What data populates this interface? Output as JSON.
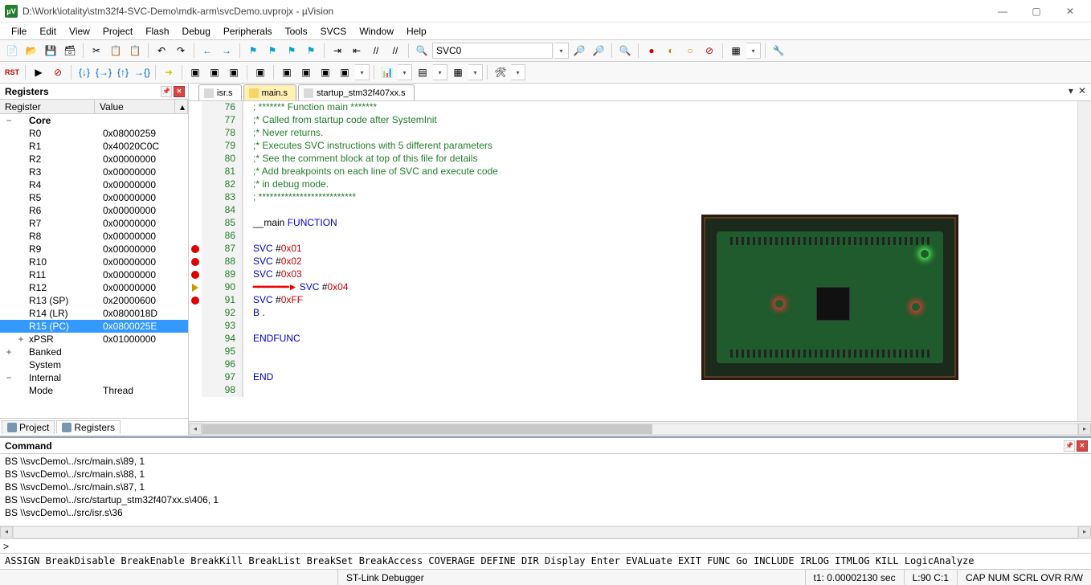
{
  "window": {
    "title": "D:\\Work\\iotality\\stm32f4-SVC-Demo\\mdk-arm\\svcDemo.uvprojx - µVision"
  },
  "menu": [
    "File",
    "Edit",
    "View",
    "Project",
    "Flash",
    "Debug",
    "Peripherals",
    "Tools",
    "SVCS",
    "Window",
    "Help"
  ],
  "toolbar": {
    "search_value": "SVC0"
  },
  "registers": {
    "title": "Registers",
    "col_register": "Register",
    "col_value": "Value",
    "groups": {
      "core": {
        "name": "Core",
        "expand": "−"
      },
      "banked": {
        "name": "Banked",
        "expand": "+"
      },
      "system": {
        "name": "System",
        "expand": ""
      },
      "internal": {
        "name": "Internal",
        "expand": "−"
      }
    },
    "core_regs": [
      {
        "n": "R0",
        "v": "0x08000259"
      },
      {
        "n": "R1",
        "v": "0x40020C0C"
      },
      {
        "n": "R2",
        "v": "0x00000000"
      },
      {
        "n": "R3",
        "v": "0x00000000"
      },
      {
        "n": "R4",
        "v": "0x00000000"
      },
      {
        "n": "R5",
        "v": "0x00000000"
      },
      {
        "n": "R6",
        "v": "0x00000000"
      },
      {
        "n": "R7",
        "v": "0x00000000"
      },
      {
        "n": "R8",
        "v": "0x00000000"
      },
      {
        "n": "R9",
        "v": "0x00000000"
      },
      {
        "n": "R10",
        "v": "0x00000000"
      },
      {
        "n": "R11",
        "v": "0x00000000"
      },
      {
        "n": "R12",
        "v": "0x00000000"
      },
      {
        "n": "R13 (SP)",
        "v": "0x20000600"
      },
      {
        "n": "R14 (LR)",
        "v": "0x0800018D"
      },
      {
        "n": "R15 (PC)",
        "v": "0x0800025E",
        "selected": true
      },
      {
        "n": "xPSR",
        "v": "0x01000000",
        "expand": "+"
      }
    ],
    "internal_regs": [
      {
        "n": "Mode",
        "v": "Thread"
      }
    ],
    "tabs": {
      "project": "Project",
      "registers": "Registers"
    }
  },
  "editor": {
    "tabs": [
      {
        "name": "isr.s",
        "active": false
      },
      {
        "name": "main.s",
        "active": true
      },
      {
        "name": "startup_stm32f407xx.s",
        "active": false
      }
    ],
    "lines": [
      {
        "n": 76,
        "t": ";  ******* Function main *******",
        "cls": "cm"
      },
      {
        "n": 77,
        "t": ";* Called from startup code after SystemInit",
        "cls": "cm"
      },
      {
        "n": 78,
        "t": ";* Never returns.",
        "cls": "cm"
      },
      {
        "n": 79,
        "t": ";* Executes SVC instructions with 5 different parameters",
        "cls": "cm"
      },
      {
        "n": 80,
        "t": ";* See the comment block at top of this file for details",
        "cls": "cm"
      },
      {
        "n": 81,
        "t": ";* Add breakpoints on each line of SVC and execute code",
        "cls": "cm"
      },
      {
        "n": 82,
        "t": ";* in debug mode.",
        "cls": "cm"
      },
      {
        "n": 83,
        "t": ";  **************************",
        "cls": "cm"
      },
      {
        "n": 84,
        "t": ""
      },
      {
        "n": 85,
        "html": "__main <span class='kw'>FUNCTION</span>"
      },
      {
        "n": 86,
        "t": ""
      },
      {
        "n": 87,
        "html": "    <span class='kw'>SVC</span> #<span class='lit'>0x01</span>",
        "bp": "red"
      },
      {
        "n": 88,
        "html": "    <span class='kw'>SVC</span> #<span class='lit'>0x02</span>",
        "bp": "red"
      },
      {
        "n": 89,
        "html": "    <span class='kw'>SVC</span> #<span class='lit'>0x03</span>",
        "bp": "red"
      },
      {
        "n": 90,
        "html": "    <span class='kw'>SVC</span> #<span class='lit'>0x04</span>",
        "bp": "yel",
        "arrow": true
      },
      {
        "n": 91,
        "html": "    <span class='kw'>SVC</span> #<span class='lit'>0xFF</span>",
        "bp": "red"
      },
      {
        "n": 92,
        "html": "    <span class='kw'>B</span>   ."
      },
      {
        "n": 93,
        "t": ""
      },
      {
        "n": 94,
        "html": "    <span class='kw'>ENDFUNC</span>"
      },
      {
        "n": 95,
        "t": ""
      },
      {
        "n": 96,
        "t": ""
      },
      {
        "n": 97,
        "html": "    <span class='kw'>END</span>"
      },
      {
        "n": 98,
        "t": ""
      }
    ]
  },
  "command": {
    "title": "Command",
    "lines": [
      "BS \\\\svcDemo\\../src/main.s\\89, 1",
      "BS \\\\svcDemo\\../src/main.s\\88, 1",
      "BS \\\\svcDemo\\../src/main.s\\87, 1",
      "BS \\\\svcDemo\\../src/startup_stm32f407xx.s\\406, 1",
      "BS \\\\svcDemo\\../src/isr.s\\36"
    ],
    "prompt": ">",
    "hints": "ASSIGN BreakDisable BreakEnable BreakKill BreakList BreakSet BreakAccess COVERAGE DEFINE DIR Display Enter EVALuate EXIT FUNC Go INCLUDE IRLOG ITMLOG KILL LogicAnalyze"
  },
  "status": {
    "debugger": "ST-Link Debugger",
    "time": "t1: 0.00002130 sec",
    "cursor": "L:90 C:1",
    "flags": "CAP NUM SCRL OVR R/W"
  }
}
